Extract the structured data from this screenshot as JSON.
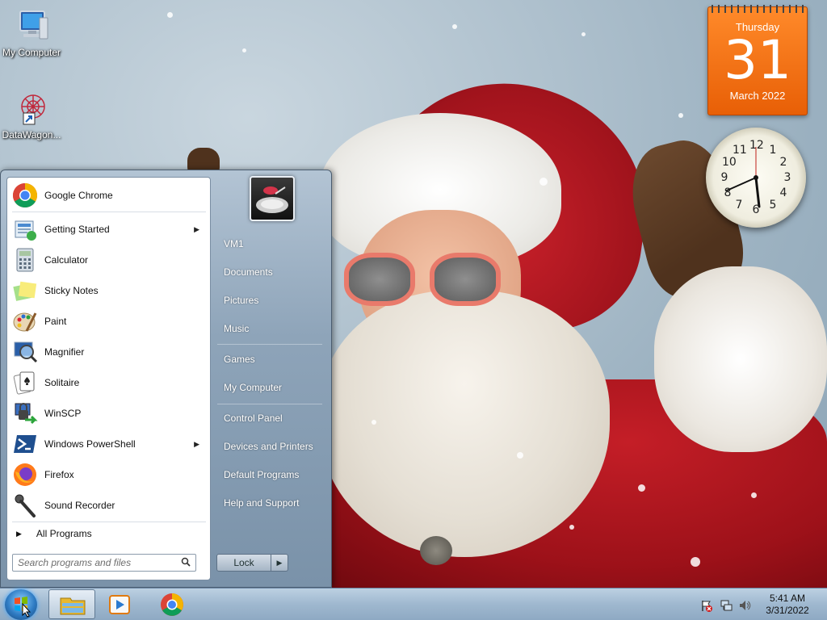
{
  "desktop": {
    "icons": [
      {
        "label": "My Computer",
        "icon": "computer-icon"
      },
      {
        "label": "DataWagon...",
        "icon": "datawagon-shortcut-icon"
      }
    ]
  },
  "calendar_gadget": {
    "weekday": "Thursday",
    "day": "31",
    "month_year": "March 2022",
    "color": "#f07010"
  },
  "clock_gadget": {
    "numbers": [
      "12",
      "1",
      "2",
      "3",
      "4",
      "5",
      "6",
      "7",
      "8",
      "9",
      "10",
      "11"
    ]
  },
  "start_menu": {
    "programs": [
      {
        "label": "Google Chrome",
        "icon": "chrome-icon",
        "submenu": false
      },
      {
        "label": "Getting Started",
        "icon": "getting-started-icon",
        "submenu": true
      },
      {
        "label": "Calculator",
        "icon": "calculator-icon",
        "submenu": false
      },
      {
        "label": "Sticky Notes",
        "icon": "sticky-notes-icon",
        "submenu": false
      },
      {
        "label": "Paint",
        "icon": "paint-icon",
        "submenu": false
      },
      {
        "label": "Magnifier",
        "icon": "magnifier-icon",
        "submenu": false
      },
      {
        "label": "Solitaire",
        "icon": "solitaire-icon",
        "submenu": false
      },
      {
        "label": "WinSCP",
        "icon": "winscp-icon",
        "submenu": false
      },
      {
        "label": "Windows PowerShell",
        "icon": "powershell-icon",
        "submenu": true
      },
      {
        "label": "Firefox",
        "icon": "firefox-icon",
        "submenu": false
      },
      {
        "label": "Sound Recorder",
        "icon": "microphone-icon",
        "submenu": false
      }
    ],
    "all_programs": "All Programs",
    "search_placeholder": "Search programs and files",
    "right_items": [
      {
        "label": "VM1"
      },
      {
        "label": "Documents"
      },
      {
        "label": "Pictures"
      },
      {
        "label": "Music"
      },
      {
        "label": "Games"
      },
      {
        "label": "My Computer"
      },
      {
        "label": "Control Panel"
      },
      {
        "label": "Devices and Printers"
      },
      {
        "label": "Default Programs"
      },
      {
        "label": "Help and Support"
      }
    ],
    "lock_label": "Lock"
  },
  "taskbar": {
    "pinned": [
      {
        "icon": "windows-explorer-icon",
        "active": true
      },
      {
        "icon": "media-player-icon",
        "active": false
      },
      {
        "icon": "chrome-icon",
        "active": false
      }
    ],
    "tray_icons": [
      "action-center-flag-icon",
      "network-icon",
      "volume-icon"
    ],
    "time": "5:41 AM",
    "date": "3/31/2022"
  }
}
